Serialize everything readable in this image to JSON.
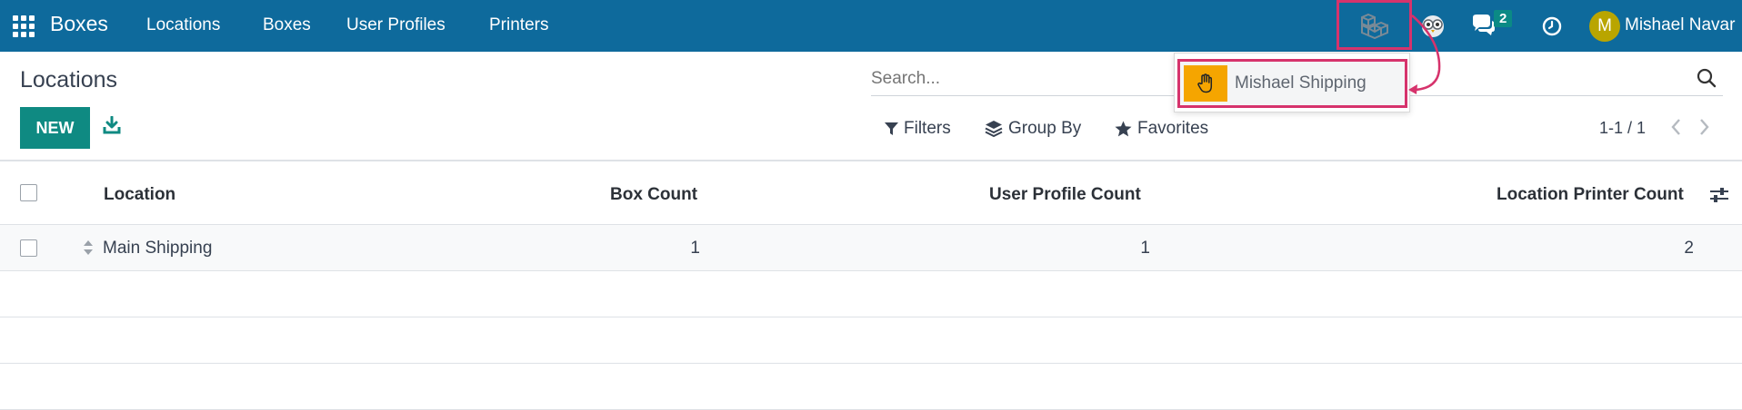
{
  "navbar": {
    "brand": "Boxes",
    "menu": [
      "Locations",
      "Boxes",
      "User Profiles",
      "Printers"
    ],
    "chat_badge": "2",
    "avatar_letter": "M",
    "user_name": "Mishael Navar"
  },
  "dropdown": {
    "item_label": "Mishael Shipping"
  },
  "control": {
    "title": "Locations",
    "new_label": "NEW",
    "search_placeholder": "Search...",
    "filters_label": "Filters",
    "groupby_label": "Group By",
    "favorites_label": "Favorites",
    "pager": "1-1 / 1"
  },
  "table": {
    "columns": [
      "Location",
      "Box Count",
      "User Profile Count",
      "Location Printer Count"
    ],
    "rows": [
      {
        "location": "Main Shipping",
        "box_count": "1",
        "user_profile_count": "1",
        "printer_count": "2"
      }
    ]
  },
  "colors": {
    "navbar": "#0e6a9c",
    "primary_button": "#0f8a82",
    "highlight": "#d6336c",
    "hand_box": "#f5a500"
  }
}
